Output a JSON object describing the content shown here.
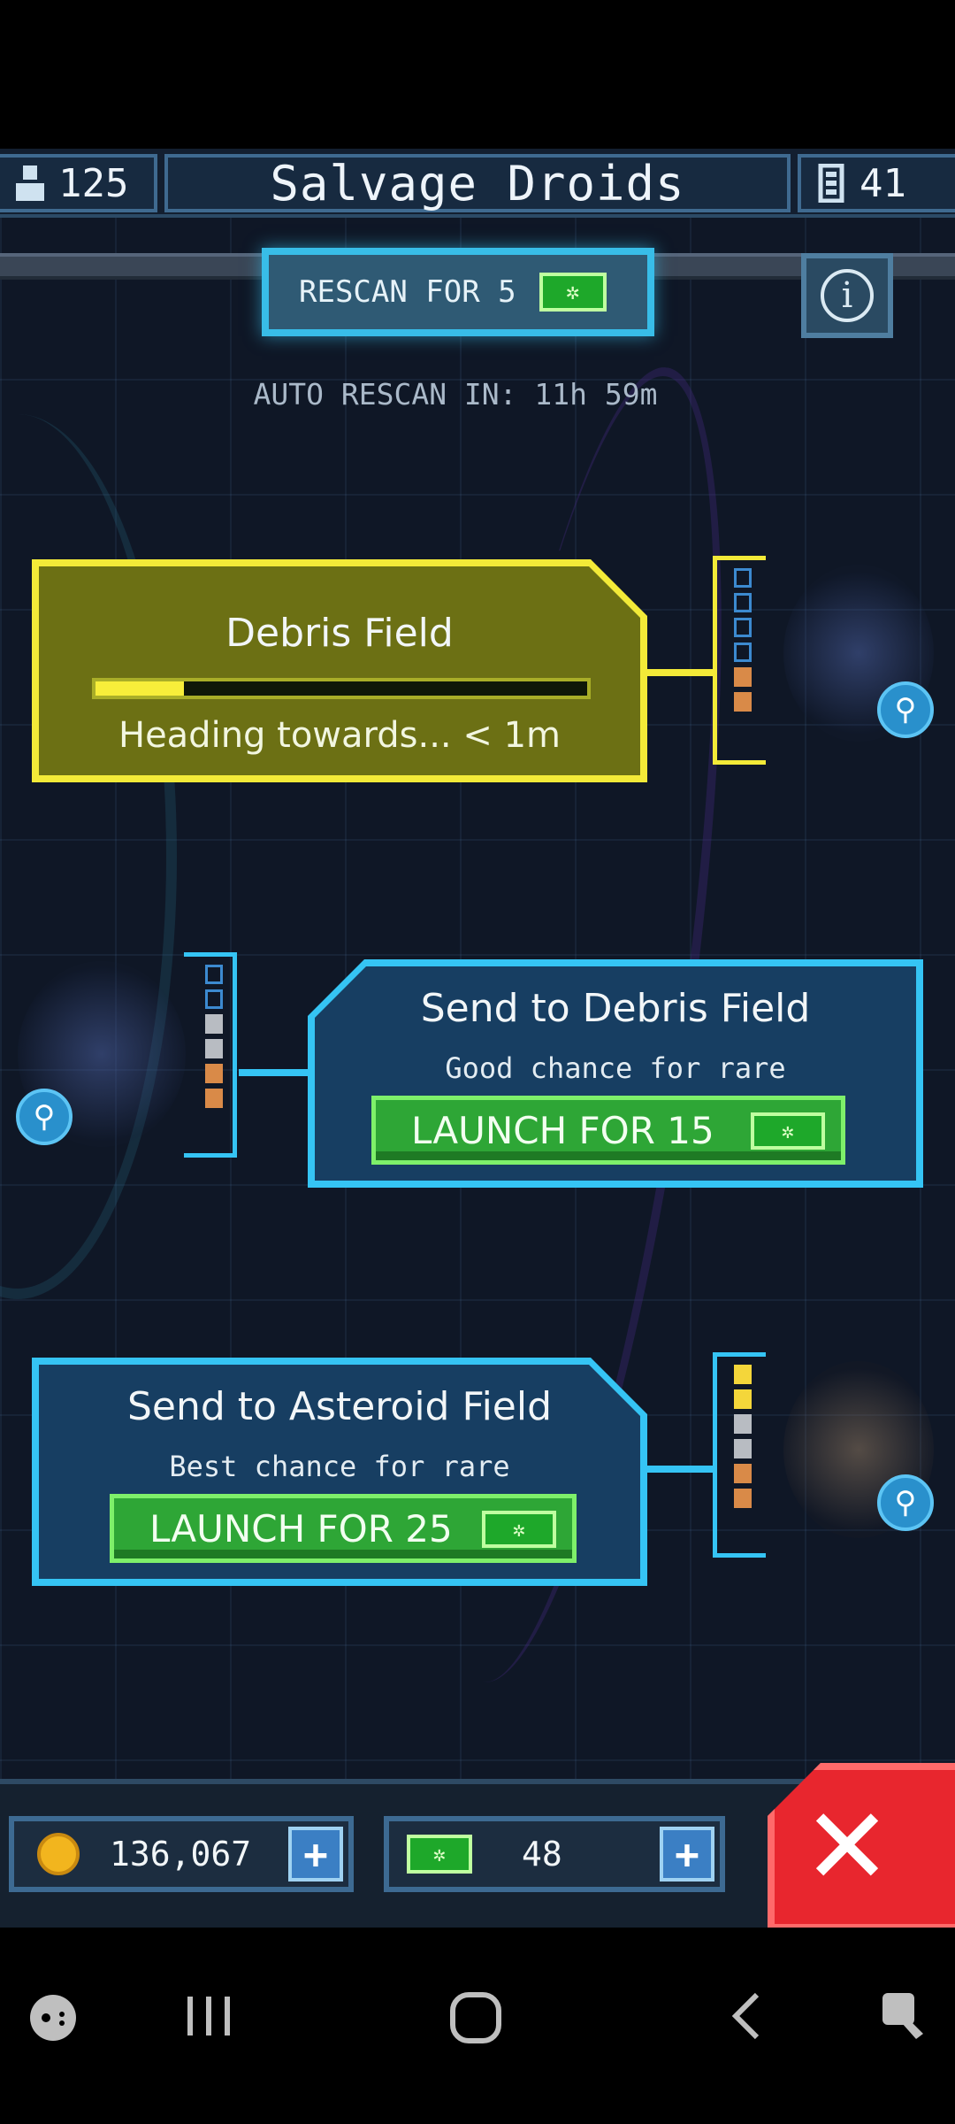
{
  "header": {
    "crew_count": "125",
    "title": "Salvage Droids",
    "cells_count": "41"
  },
  "rescan": {
    "button_label": "RESCAN FOR 5",
    "auto_rescan_text": "AUTO RESCAN IN: 11h 59m",
    "info_label": "i"
  },
  "missions": [
    {
      "title": "Debris Field",
      "status": "Heading towards... < 1m",
      "progress": 0.18,
      "state": "in-progress"
    },
    {
      "title": "Send to Debris Field",
      "subtitle": "Good chance for rare",
      "launch_label": "LAUNCH FOR 15"
    },
    {
      "title": "Send to Asteroid Field",
      "subtitle": "Best chance for rare",
      "launch_label": "LAUNCH FOR 25"
    }
  ],
  "resources": {
    "coins": "136,067",
    "gems": "48"
  },
  "colors": {
    "in_progress": "#f3ea38",
    "available": "#35c4f4",
    "launch": "#2ea636",
    "close": "#e8262e"
  },
  "icons": {
    "crew": "person-icon",
    "cells": "battery-icon",
    "gem": "gem-icon",
    "coin": "coin-icon",
    "zoom": "magnifier-icon",
    "close": "close-icon"
  }
}
